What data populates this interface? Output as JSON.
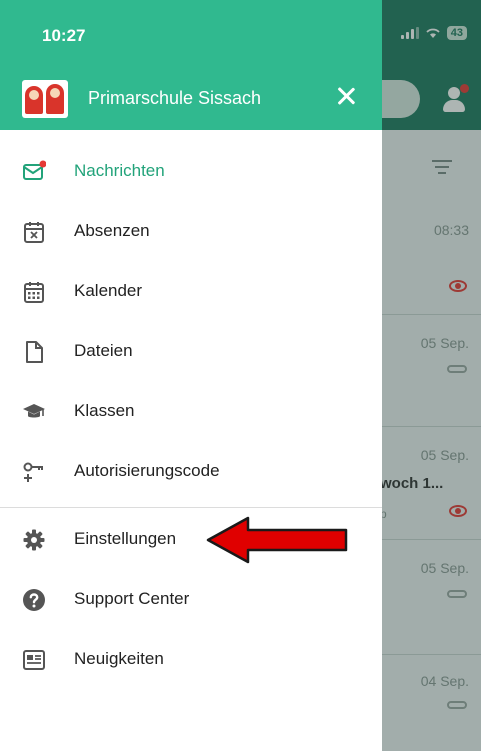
{
  "status_bar": {
    "time": "10:27",
    "battery": "43"
  },
  "drawer": {
    "school_name": "Primarschule Sissach",
    "menu_primary": [
      {
        "label": "Nachrichten",
        "icon": "mail-icon",
        "active": true
      },
      {
        "label": "Absenzen",
        "icon": "calendar-x-icon"
      },
      {
        "label": "Kalender",
        "icon": "calendar-icon"
      },
      {
        "label": "Dateien",
        "icon": "file-icon"
      },
      {
        "label": "Klassen",
        "icon": "graduation-cap-icon"
      },
      {
        "label": "Autorisierungscode",
        "icon": "key-icon"
      }
    ],
    "menu_secondary": [
      {
        "label": "Einstellungen",
        "icon": "gear-icon"
      },
      {
        "label": "Support Center",
        "icon": "help-icon"
      },
      {
        "label": "Neuigkeiten",
        "icon": "news-icon"
      }
    ]
  },
  "background_list": {
    "rows": [
      {
        "time": "08:33",
        "indicator": "eye"
      },
      {
        "time": "05 Sep.",
        "indicator": "clip"
      },
      {
        "time": "05 Sep.",
        "snippet": "woch 1...",
        "snippet2": "p",
        "indicator": "eye"
      },
      {
        "time": "05 Sep.",
        "indicator": "clip"
      },
      {
        "time": "04 Sep.",
        "indicator": "clip"
      }
    ]
  },
  "colors": {
    "drawer_header": "#30b98f",
    "app_header": "#1f7a5f",
    "accent": "#22a37a",
    "annotation_arrow": "#e00000",
    "notification_dot": "#e53935"
  }
}
